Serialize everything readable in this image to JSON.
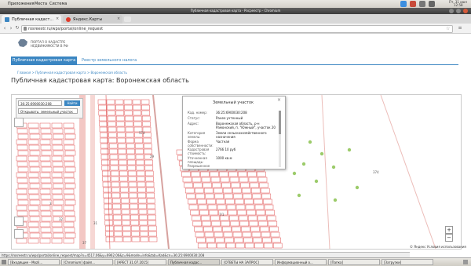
{
  "panel": {
    "menu_apps": "Приложения",
    "menu_places": "Места",
    "menu_system": "Система",
    "clock_day": "Пт, 31 июл",
    "clock_time": "12:58"
  },
  "window": {
    "title": "Публичная кадастровая карта - Росреестр - Chromium"
  },
  "tabs": [
    {
      "label": "Публичная кадаст..."
    },
    {
      "label": "Яндекс.Карты"
    }
  ],
  "address": {
    "url": "rosreestr.ru/wps/portal/online_request"
  },
  "site": {
    "logo_line1": "ПОРТАЛ О КАДАСТРЕ",
    "logo_line2": "НЕДВИЖИМОСТИ В РФ",
    "nav_active": "Публичная кадастровая карта",
    "nav_second": "Реестр земельного налога",
    "breadcrumb": "Главная  >  Публичная кадастровая карта  >  Воронежская область",
    "page_title": "Публичная кадастровая карта: Воронежская область"
  },
  "search": {
    "input_value": "36:25:6900030:208",
    "button_label": "Найти",
    "type_value": "Открывать: земельный участок"
  },
  "popup": {
    "title": "Земельный участок",
    "rows": [
      {
        "label": "Кад. номер:",
        "value": "36:25:6900030:208"
      },
      {
        "label": "Статус:",
        "value": "Ранее учтенный"
      },
      {
        "label": "Адрес:",
        "value": "Воронежская область, р-н Рамонский, п. \"Южный\", участок 20"
      },
      {
        "label": "Категория земель:",
        "value": "Земли сельскохозяйственного назначения"
      },
      {
        "label": "Форма собственности:",
        "value": "Частная"
      },
      {
        "label": "Кадастровая стоимость:",
        "value": "2766 10 руб"
      },
      {
        "label": "Уточненная площадь:",
        "value": "1000 кв.м"
      },
      {
        "label": "Разрешенное",
        "value": ""
      }
    ]
  },
  "map": {
    "labels": [
      "29",
      "31",
      "7/1",
      "574",
      "37",
      "15",
      "374",
      "300",
      "32",
      "3"
    ],
    "footer": "© Яндекс  Условия использования"
  },
  "status_url": "https://rosreestr.ru/wps/portal/online_request/map?x=4517.06&y=6962.06&z=9&mode=info&tab=Kad&cn=36:25:6900030:208",
  "taskbar": {
    "items": [
      "[Входящие - Mozil...",
      "[Chromium] файл...",
      "[АРЕСТ 31.07.2015]",
      "Публичная кадас...",
      "[ОТВЕТЫ НА ЗАПРОС]",
      "Информационный о...",
      "[Папка]",
      "[Загрузки]"
    ]
  },
  "colors": {
    "accent": "#3b86c2",
    "road": "#f3c7c4",
    "parcel": "#e05050",
    "lot_dot": "#9ccb6a"
  }
}
